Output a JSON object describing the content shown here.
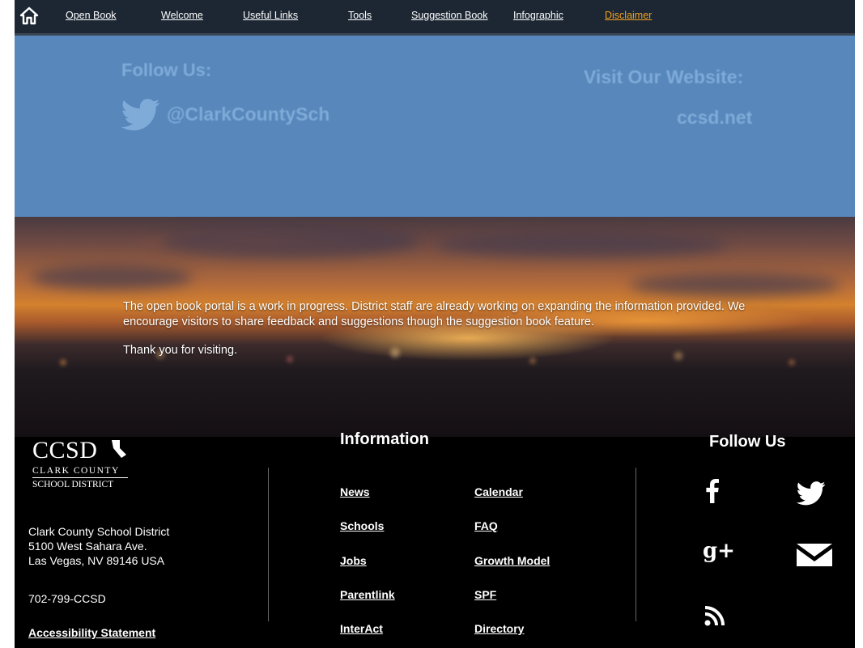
{
  "nav": {
    "items": [
      {
        "label": "Open Book",
        "active": false
      },
      {
        "label": "Welcome",
        "active": false
      },
      {
        "label": "Useful Links",
        "active": false
      },
      {
        "label": "Tools",
        "active": false
      },
      {
        "label": "Suggestion Book",
        "active": false
      },
      {
        "label": "Infographic",
        "active": false
      },
      {
        "label": "Disclaimer",
        "active": true
      }
    ],
    "home_icon": "home-icon",
    "accent_color": "#f0a020"
  },
  "hero": {
    "follow_title": "Follow Us:",
    "twitter_handle": "@ClarkCountySch",
    "visit_title": "Visit Our Website:",
    "website": "ccsd.net",
    "background_color": "#5787bb"
  },
  "disclaimer": {
    "paragraph1": "The open book portal is a work in progress. District staff are already working on expanding the information provided. We encourage visitors to share feedback and suggestions though the suggestion book feature.",
    "paragraph2": "Thank you for visiting."
  },
  "footer": {
    "logo": {
      "main": "CCSD",
      "line1": "CLARK COUNTY",
      "line2": "SCHOOL DISTRICT"
    },
    "address": [
      "Clark County School District",
      "5100 West Sahara Ave.",
      "Las Vegas, NV 89146 USA"
    ],
    "phone": "702-799-CCSD",
    "accessibility": "Accessibility Statement",
    "information_title": "Information",
    "links_col1": [
      "News",
      "Schools",
      "Jobs",
      "Parentlink",
      "InterAct"
    ],
    "links_col2": [
      "Calendar",
      "FAQ",
      "Growth Model",
      "SPF",
      "Directory"
    ],
    "follow_title": "Follow Us",
    "social_icons": [
      "facebook-icon",
      "twitter-icon",
      "google-plus-icon",
      "email-icon",
      "rss-icon"
    ],
    "google_plus_glyph": "g+"
  }
}
